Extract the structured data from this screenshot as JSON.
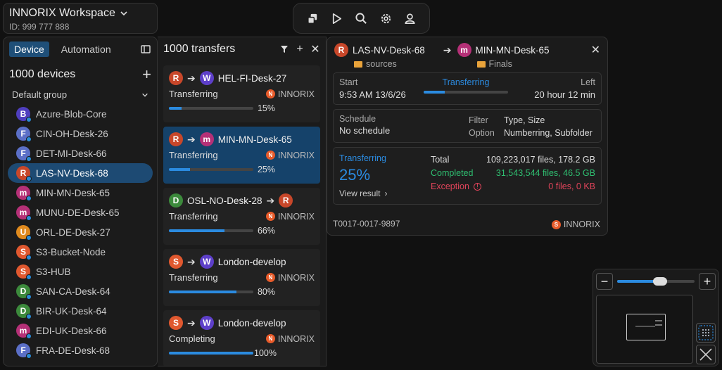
{
  "workspace": {
    "title": "INNORIX Workspace",
    "id": "ID: 999 777 888"
  },
  "colors": {
    "accent": "#2b8be0",
    "selected": "#1d4a73",
    "completed": "#2fbf71",
    "exception": "#e0445a",
    "brand": "#e85b2a"
  },
  "toolbar": {
    "icons": [
      "copy-icon",
      "play-icon",
      "search-icon",
      "gear-icon",
      "user-icon"
    ]
  },
  "devices_panel": {
    "tabs": [
      {
        "label": "Device",
        "active": true
      },
      {
        "label": "Automation",
        "active": false
      }
    ],
    "count": "1000  devices",
    "group": "Default group",
    "items": [
      {
        "letter": "B",
        "name": "Azure-Blob-Core",
        "color": "#4f3fbf",
        "online": true
      },
      {
        "letter": "F",
        "name": "CIN-OH-Desk-26",
        "color": "#5b6fc7",
        "online": true
      },
      {
        "letter": "F",
        "name": "DET-MI-Desk-66",
        "color": "#5b6fc7",
        "online": true
      },
      {
        "letter": "R",
        "name": "LAS-NV-Desk-68",
        "color": "#c8472a",
        "online": true,
        "selected": true
      },
      {
        "letter": "m",
        "name": "MIN-MN-Desk-65",
        "color": "#b53077",
        "online": true
      },
      {
        "letter": "m",
        "name": "MUNU-DE-Desk-65",
        "color": "#b53077",
        "online": true
      },
      {
        "letter": "U",
        "name": "ORL-DE-Desk-27",
        "color": "#e08a1e",
        "online": true
      },
      {
        "letter": "S",
        "name": "S3-Bucket-Node",
        "color": "#e0582f",
        "online": true
      },
      {
        "letter": "S",
        "name": "S3-HUB",
        "color": "#e0582f",
        "online": true
      },
      {
        "letter": "D",
        "name": "SAN-CA-Desk-64",
        "color": "#3c8a3c",
        "online": true
      },
      {
        "letter": "D",
        "name": "BIR-UK-Desk-64",
        "color": "#3c8a3c",
        "online": true
      },
      {
        "letter": "m",
        "name": "EDI-UK-Desk-66",
        "color": "#b53077",
        "online": true
      },
      {
        "letter": "F",
        "name": "FRA-DE-Desk-68",
        "color": "#5b6fc7",
        "online": true
      }
    ]
  },
  "transfers_panel": {
    "count": "1000  transfers",
    "brand": "INNORIX",
    "cards": [
      {
        "from_letter": "R",
        "from_color": "#c8472a",
        "to_letter": "W",
        "to_color": "#5d3fc9",
        "name": "HEL-FI-Desk-27",
        "name_side": "to",
        "status": "Transferring",
        "percent": "15%",
        "progress": 0.15
      },
      {
        "from_letter": "R",
        "from_color": "#c8472a",
        "to_letter": "m",
        "to_color": "#b53077",
        "name": "MIN-MN-Desk-65",
        "name_side": "to",
        "status": "Transferring",
        "percent": "25%",
        "progress": 0.25,
        "selected": true
      },
      {
        "from_letter": "D",
        "from_color": "#3c8a3c",
        "to_letter": "R",
        "to_color": "#c8472a",
        "name": "OSL-NO-Desk-28",
        "name_side": "from",
        "status": "Transferring",
        "percent": "66%",
        "progress": 0.66
      },
      {
        "from_letter": "S",
        "from_color": "#e0582f",
        "to_letter": "W",
        "to_color": "#5d3fc9",
        "name": "London-develop",
        "name_side": "to",
        "status": "Transferring",
        "percent": "80%",
        "progress": 0.8
      },
      {
        "from_letter": "S",
        "from_color": "#e0582f",
        "to_letter": "W",
        "to_color": "#5d3fc9",
        "name": "London-develop",
        "name_side": "to",
        "status": "Completing",
        "percent": "100%",
        "progress": 1.0
      }
    ]
  },
  "detail": {
    "source": {
      "letter": "R",
      "color": "#c8472a",
      "name": "LAS-NV-Desk-68",
      "folder": "sources"
    },
    "dest": {
      "letter": "m",
      "color": "#b53077",
      "name": "MIN-MN-Desk-65",
      "folder": "Finals"
    },
    "start_label": "Start",
    "start_value": "9:53 AM 13/6/26",
    "status": "Transferring",
    "progress": 0.25,
    "left_label": "Left",
    "left_value": "20 hour 12 min",
    "schedule_label": "Schedule",
    "schedule_value": "No schedule",
    "filter_label": "Filter",
    "filter_value": "Type, Size",
    "option_label": "Option",
    "option_value": "Numberring, Subfolder",
    "big_status": "Transferring",
    "big_percent": "25%",
    "view_result": "View result",
    "total_label": "Total",
    "total_value": "109,223,017 files,  178.2 GB",
    "completed_label": "Completed",
    "completed_value": "31,543,544 files,  46.5 GB",
    "exception_label": "Exception",
    "exception_value": "0 files,  0 KB",
    "transfer_id": "T0017-0017-9897",
    "brand": "INNORIX"
  },
  "zoom": {
    "level": 0.55
  }
}
